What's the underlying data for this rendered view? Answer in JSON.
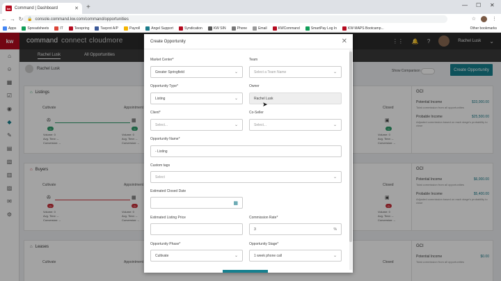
{
  "browser": {
    "tab_title": "Command | Dashboard",
    "tab_favicon": "kw",
    "url": "console.command.kw.com/command/opportunities",
    "bookmarks": [
      "Apps",
      "Spreadsheets",
      "IT",
      "Teespring",
      "Taxprot A/P",
      "Payroll",
      "Angel Support",
      "Syndication",
      "KW SIN",
      "Phone",
      "Email",
      "KWCommand",
      "SmartPay Log In",
      "KW MAPS Bootcamp..."
    ],
    "other_bookmarks": "Other bookmarks"
  },
  "app": {
    "logo": "kw",
    "brand": [
      "command",
      "connect",
      "cloudmore"
    ],
    "user_name": "Rachel Lusk",
    "subnav_tabs": [
      "Rachel Lusk",
      "All Opportunities"
    ],
    "agent_chip": "Rachel Lusk",
    "show_comparison": "Show Comparison",
    "create_button": "Create Opportunity",
    "cards": [
      {
        "title": "Listings",
        "stages": [
          "Cultivate",
          "Appointment",
          "Closed"
        ],
        "count": "0",
        "metrics": [
          "Volume: 0",
          "Avg. Time: --",
          "Conversion: --"
        ],
        "gci_title": "GCI",
        "potential_label": "Potential Income",
        "potential_value": "$33,000.00",
        "potential_note": "Total commission from all opportunities",
        "probable_label": "Probable Income",
        "probable_value": "$25,500.00",
        "probable_note": "Adjusted commission based on each stage's probability to close"
      },
      {
        "title": "Buyers",
        "stages": [
          "Cultivate",
          "Appointment",
          "Closed"
        ],
        "count": "0",
        "metrics": [
          "Volume: 0",
          "Avg. Time: --",
          "Conversion: --"
        ],
        "gci_title": "GCI",
        "potential_label": "Potential Income",
        "potential_value": "$6,000.00",
        "potential_note": "Total commission from all opportunities",
        "probable_label": "Probable Income",
        "probable_value": "$5,400.00",
        "probable_note": "Adjusted commission based on each stage's probability to close"
      },
      {
        "title": "Leases",
        "stages": [
          "Cultivate",
          "Appointment",
          "Closed"
        ],
        "gci_title": "GCI",
        "potential_label": "Potential Income",
        "potential_value": "$0.00",
        "potential_note": "Total commission from all opportunities"
      }
    ]
  },
  "modal": {
    "title": "Create Opportunity",
    "fields": {
      "market_center": {
        "label": "Market Center*",
        "value": "Greater Springfield"
      },
      "team": {
        "label": "Team",
        "placeholder": "Select a Team Name"
      },
      "opportunity_type": {
        "label": "Opportunity Type*",
        "value": "Listing"
      },
      "owner": {
        "label": "Owner",
        "value": "Rachel Lusk"
      },
      "client": {
        "label": "Client*",
        "placeholder": "Select..."
      },
      "co_seller": {
        "label": "Co-Seller",
        "placeholder": "Select..."
      },
      "opportunity_name": {
        "label": "Opportunity Name*",
        "value": "- Listing"
      },
      "custom_tags": {
        "label": "Custom tags",
        "placeholder": "Select"
      },
      "closed_date": {
        "label": "Estimated Closed Date",
        "value": ""
      },
      "listing_price": {
        "label": "Estimated Listing Price",
        "value": ""
      },
      "commission_rate": {
        "label": "Commission Rate*",
        "value": "3",
        "suffix": "%"
      },
      "opportunity_phase": {
        "label": "Opportunity Phase*",
        "value": "Cultivate"
      },
      "opportunity_stage": {
        "label": "Opportunity Stage*",
        "value": "1 week phone call"
      }
    }
  },
  "colors": {
    "brand_red": "#b40a1e",
    "accent_teal": "#16808f",
    "pipeline_green": "#2e9b6b",
    "pipeline_red": "#c8323c"
  }
}
